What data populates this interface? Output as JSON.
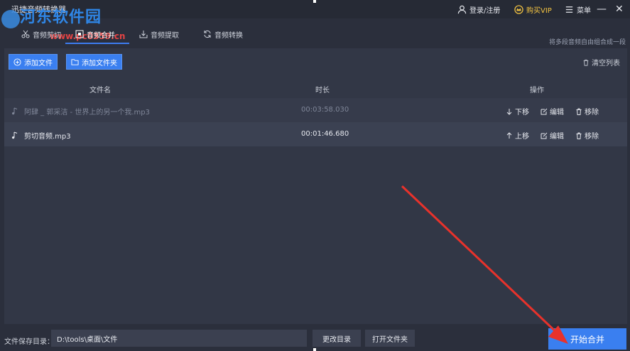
{
  "window": {
    "title": "迅捷音频转换器",
    "login_label": "登录/注册",
    "vip_label": "购买VIP",
    "menu_label": "菜单",
    "min_glyph": "—",
    "close_glyph": "✕"
  },
  "watermark": {
    "brand": "河东软件园",
    "url": "www.pc0359.cn"
  },
  "tabs": [
    {
      "label": "音频剪切",
      "icon": "scissors-icon"
    },
    {
      "label": "音频合并",
      "icon": "merge-icon"
    },
    {
      "label": "音频提取",
      "icon": "extract-icon"
    },
    {
      "label": "音频转换",
      "icon": "convert-icon"
    }
  ],
  "tip": "将多段音频自由组合成一段",
  "toolbar": {
    "add_file": "添加文件",
    "add_folder": "添加文件夹",
    "clear_list": "清空列表"
  },
  "table": {
    "columns": [
      "文件名",
      "时长",
      "操作"
    ],
    "rows": [
      {
        "name": "阿肆 _ 郭采洁 - 世界上的另一个我.mp3",
        "duration": "00:03:58.030",
        "move": "下移",
        "edit": "编辑",
        "remove": "移除"
      },
      {
        "name": "剪切音频.mp3",
        "duration": "00:01:46.680",
        "move": "上移",
        "edit": "编辑",
        "remove": "移除"
      }
    ]
  },
  "bottom": {
    "save_label": "文件保存目录：",
    "path": "D:\\tools\\桌面\\文件",
    "change_dir": "更改目录",
    "open_folder": "打开文件夹",
    "start": "开始合并"
  },
  "colors": {
    "accent": "#3a7ff0",
    "annotation_arrow": "#e8322b"
  }
}
